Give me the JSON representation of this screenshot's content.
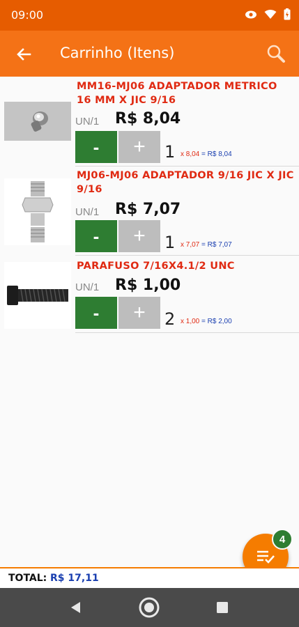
{
  "status_bar": {
    "time": "09:00"
  },
  "app_bar": {
    "title": "Carrinho (Itens)"
  },
  "items": [
    {
      "name": "MM16-MJ06 ADAPTADOR METRICO 16 MM X JIC 9/16",
      "unit": "UN/1",
      "price": "R$ 8,04",
      "qty": "1",
      "calc_mult": "x 8,04",
      "calc_eq": "= R$ 8,04",
      "minus": "-",
      "plus": "+"
    },
    {
      "name": "MJ06-MJ06 ADAPTADOR 9/16 JIC X JIC 9/16",
      "unit": "UN/1",
      "price": "R$ 7,07",
      "qty": "1",
      "calc_mult": "x 7,07",
      "calc_eq": "= R$ 7,07",
      "minus": "-",
      "plus": "+"
    },
    {
      "name": "PARAFUSO 7/16X4.1/2 UNC",
      "unit": "UN/1",
      "price": "R$ 1,00",
      "qty": "2",
      "calc_mult": "x 1,00",
      "calc_eq": "= R$ 2,00",
      "minus": "-",
      "plus": "+"
    }
  ],
  "fab": {
    "badge": "4",
    "icon": "playlist-check-icon"
  },
  "total": {
    "label": "TOTAL:",
    "value": "R$ 17,11"
  },
  "colors": {
    "status": "#e65c00",
    "appbar": "#f47216",
    "accent": "#f57c00",
    "name_red": "#e02a12",
    "minus_green": "#2e7d32",
    "total_blue": "#1a3fb0"
  }
}
